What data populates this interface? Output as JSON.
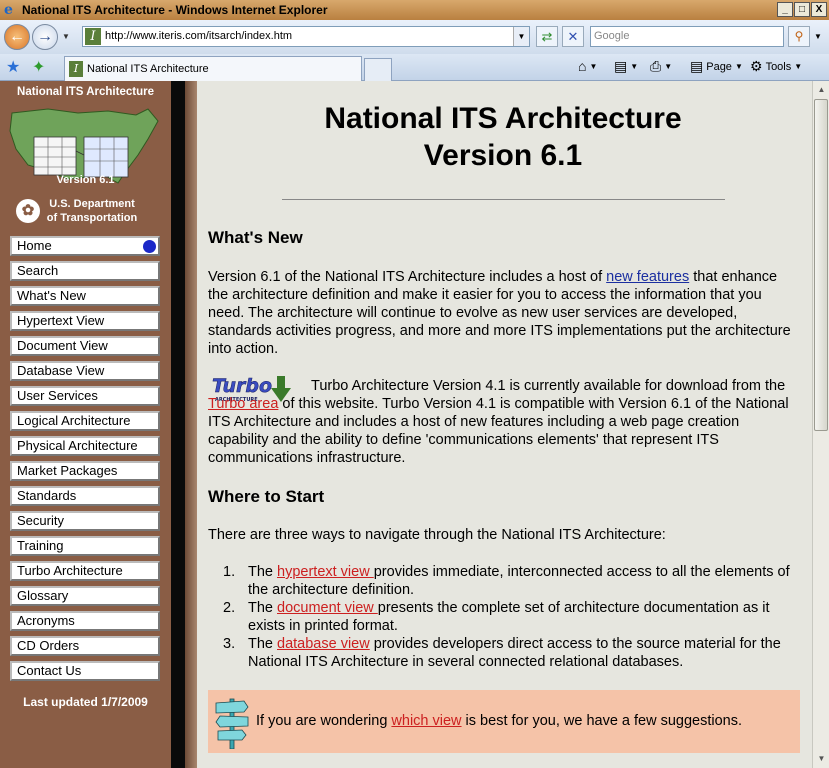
{
  "window": {
    "title": "National ITS Architecture - Windows Internet Explorer",
    "controls": [
      "_",
      "□",
      "X"
    ]
  },
  "toolbar": {
    "url": "http://www.iteris.com/itsarch/index.htm",
    "search_placeholder": "Google",
    "tab_title": "National ITS Architecture",
    "page_label": "Page",
    "tools_label": "Tools"
  },
  "sidebar": {
    "title": "National ITS Architecture",
    "version_badge": "Version 6.1",
    "dot_line1": "U.S. Department",
    "dot_line2": "of Transportation",
    "items": [
      {
        "label": "Home",
        "active": true
      },
      {
        "label": "Search"
      },
      {
        "label": "What's New"
      },
      {
        "label": "Hypertext View"
      },
      {
        "label": "Document View"
      },
      {
        "label": "Database View"
      },
      {
        "label": "User Services"
      },
      {
        "label": "Logical Architecture"
      },
      {
        "label": "Physical Architecture"
      },
      {
        "label": "Market Packages"
      },
      {
        "label": "Standards"
      },
      {
        "label": "Security"
      },
      {
        "label": "Training"
      },
      {
        "label": "Turbo Architecture"
      },
      {
        "label": "Glossary"
      },
      {
        "label": "Acronyms"
      },
      {
        "label": "CD Orders"
      },
      {
        "label": "Contact Us"
      }
    ],
    "last_updated": "Last updated 1/7/2009"
  },
  "main": {
    "title_line1": "National ITS Architecture",
    "title_line2": "Version 6.1",
    "whats_new_heading": "What's New",
    "whats_new": {
      "pre": "Version 6.1 of the National ITS Architecture includes a host of ",
      "link": "new features",
      "post": " that enhance the architecture definition and make it easier for you to access the information that you need.  The architecture will continue to evolve as new user services are developed, standards activities progress, and more and more ITS implementations put the architecture into action."
    },
    "turbo": {
      "logo_text": "Turbo",
      "logo_sub": "ARCHITECTURE",
      "pre": "Turbo Architecture Version 4.1 is currently available for download from the ",
      "link": "Turbo area",
      "post": " of this website. Turbo Version 4.1 is compatible with Version 6.1 of the National ITS Architecture and includes a host of new features including a web page creation capability and the ability to define 'communications elements' that represent ITS communications infrastructure."
    },
    "where_heading": "Where to Start",
    "where_intro": "There are three ways to navigate through the National ITS Architecture:",
    "ways": [
      {
        "num": "1.",
        "pre": "The ",
        "link": "hypertext view ",
        "post": "provides immediate, interconnected access to all the elements of the architecture definition."
      },
      {
        "num": "2.",
        "pre": "The ",
        "link": "document view ",
        "post": "presents the complete set of architecture documentation as it exists in printed format."
      },
      {
        "num": "3.",
        "pre": "The ",
        "link": "database view",
        "post": " provides developers direct access to the source material for the National ITS Architecture in several connected relational databases."
      }
    ],
    "tip": {
      "pre": "If you are wondering ",
      "link": "which view",
      "post": " is best for you, we have a few suggestions."
    }
  },
  "colors": {
    "sidebar_bg": "#8a5d45",
    "page_bg": "#e6e6df",
    "link_blue": "#1b2fa0",
    "link_red": "#cc2020",
    "tip_bg": "#f5c3a8"
  }
}
